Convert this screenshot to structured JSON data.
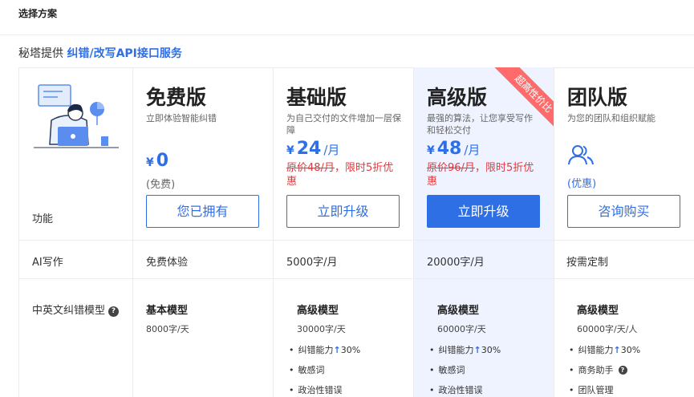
{
  "header": {
    "title": "选择方案"
  },
  "subtitle": {
    "prefix": "秘塔提供",
    "highlight": "纠错/改写API接口服务"
  },
  "features": {
    "function_label": "功能",
    "ai_writing_label": "AI写作",
    "correction_model_label": "中英文纠错模型"
  },
  "plans": [
    {
      "name": "免费版",
      "desc": "立即体验智能纠错",
      "currency": "¥",
      "price": "0",
      "unit": "",
      "note": "(免费)",
      "button": "您已拥有",
      "ai_writing": "免费体验",
      "model": "基本模型",
      "quota": "8000字/天",
      "bullets": []
    },
    {
      "name": "基础版",
      "desc": "为自己交付的文件增加一层保障",
      "currency": "¥",
      "price": "24",
      "unit": "/月",
      "old_price": "原价48/月",
      "promo": "，限时5折优惠",
      "button": "立即升级",
      "ai_writing": "5000字/月",
      "model": "高级模型",
      "quota": "30000字/天",
      "bullets": [
        {
          "text": "纠错能力",
          "arrow": "↑",
          "value": "30%"
        },
        {
          "text": "敏感词"
        },
        {
          "text": "政治性错误"
        }
      ]
    },
    {
      "name": "高级版",
      "desc": "最强的算法，让您享受写作和轻松交付",
      "currency": "¥",
      "price": "48",
      "unit": "/月",
      "old_price": "原价96/月",
      "promo": "，限时5折优惠",
      "button": "立即升级",
      "ribbon": "超高性价比",
      "ai_writing": "20000字/月",
      "model": "高级模型",
      "quota": "60000字/天",
      "bullets": [
        {
          "text": "纠错能力",
          "arrow": "↑",
          "value": "30%"
        },
        {
          "text": "敏感词"
        },
        {
          "text": "政治性错误"
        }
      ]
    },
    {
      "name": "团队版",
      "desc": "为您的团队和组织赋能",
      "icon": "team-users-icon",
      "note": "(优惠)",
      "button": "咨询购买",
      "ai_writing": "按需定制",
      "model": "高级模型",
      "quota": "60000字/天/人",
      "bullets": [
        {
          "text": "纠错能力",
          "arrow": "↑",
          "value": "30%"
        },
        {
          "text": "商务助手"
        },
        {
          "text": "团队管理"
        }
      ]
    }
  ],
  "colors": {
    "accent": "#2f6fe6",
    "promo_red": "#e4393c",
    "ribbon": "#ff6b6b",
    "highlight_col": "#eef3ff"
  }
}
